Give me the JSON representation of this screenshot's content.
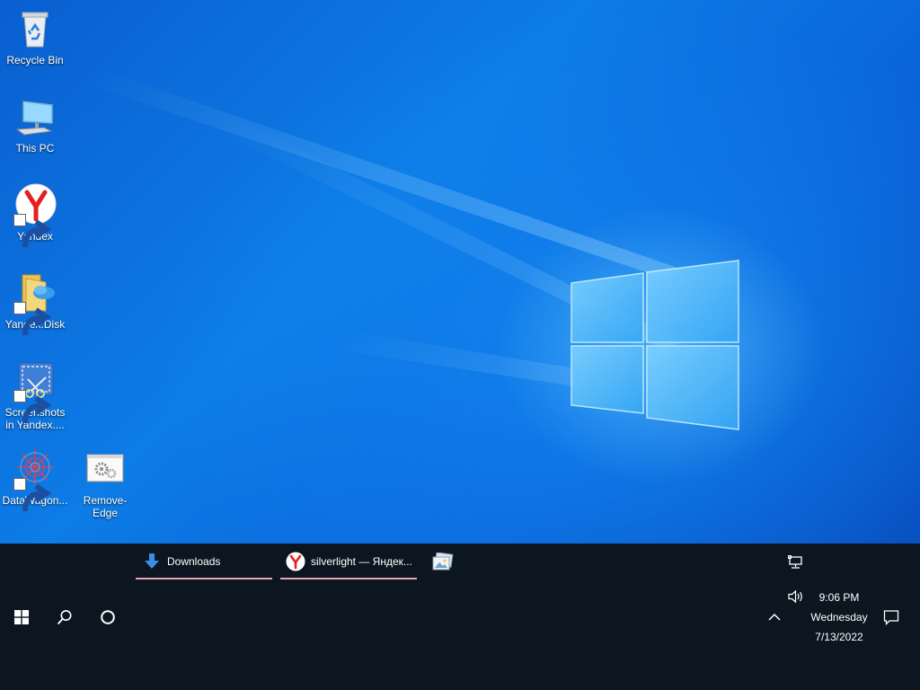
{
  "desktop": {
    "icons": [
      {
        "label": "Recycle Bin"
      },
      {
        "label": "This PC"
      },
      {
        "label": "Yandex"
      },
      {
        "label": "Yandex.Disk"
      },
      {
        "label": "Screenshots in Yandex...."
      },
      {
        "label": "DataWagon..."
      },
      {
        "label": "Remove-Edge"
      }
    ]
  },
  "taskbar": {
    "apps": [
      {
        "label": "Downloads",
        "icon": "download-arrow-icon"
      },
      {
        "label": "silverlight — Яндек...",
        "icon": "yandex-browser-icon"
      },
      {
        "label": "",
        "icon": "photo-viewer-icon"
      }
    ],
    "clock": {
      "time": "9:06 PM",
      "day": "Wednesday",
      "date": "7/13/2022"
    }
  },
  "colors": {
    "accent": "#0a6fe0",
    "taskbar_bg": "#0b1620",
    "app_underline": "#e9a5b4",
    "yandex_red": "#e62020"
  }
}
